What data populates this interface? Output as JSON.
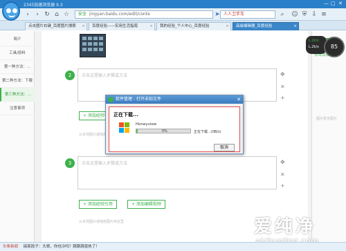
{
  "browser": {
    "app_title": "2345加速浏览器 9.3",
    "url": "jingyan.baidu.com/edit/conte",
    "safe_label": "安全",
    "search_text": "人人卫手车",
    "tabs": [
      {
        "label": "点击图片右键_百度图片搜索"
      },
      {
        "label": "百度经验——实用生活指南"
      },
      {
        "label": "我的经验_个人中心_百度经验"
      },
      {
        "label": "高级编辑器_百度经验"
      }
    ]
  },
  "sidebar": {
    "items": [
      {
        "label": "简介"
      },
      {
        "label": "工具/原料"
      },
      {
        "label": "第一种方法：..."
      },
      {
        "label": "第二种方法：下载"
      },
      {
        "label": "第三种方法：..."
      },
      {
        "label": "注意事项"
      }
    ]
  },
  "editor": {
    "steps": [
      {
        "num": "2",
        "placeholder": "点击这里输入步骤或方法"
      },
      {
        "num": "3",
        "placeholder": "点击这里输入步骤或方法"
      }
    ],
    "add_quote_label": "+ 添加经验引用",
    "add_video_label": "+ 添加编辑视频",
    "hint_text": "从本地图片或拖放图片到这里"
  },
  "right_panel": {
    "add_image_label": "点击添加图片",
    "no_image_text": "图片暂无图片"
  },
  "net_widget": {
    "speed": "85",
    "up": "L.2k/s",
    "down": "L.2k/s"
  },
  "dialog": {
    "title": "软件管理 - 打开未知文件",
    "heading": "正在下载...",
    "app_name": "Honeyview",
    "progress_percent": "0%",
    "progress_value": 0.02,
    "status": "正在下载...(0B/s)",
    "cancel_label": "取消"
  },
  "statusbar": {
    "news_label": "头条新闻",
    "news_text": "搞笑段子：大哥，你也冷吗？跳跳跳就热了！"
  },
  "watermark": {
    "brand": "爱纯净",
    "site": "aichunjing.com"
  }
}
